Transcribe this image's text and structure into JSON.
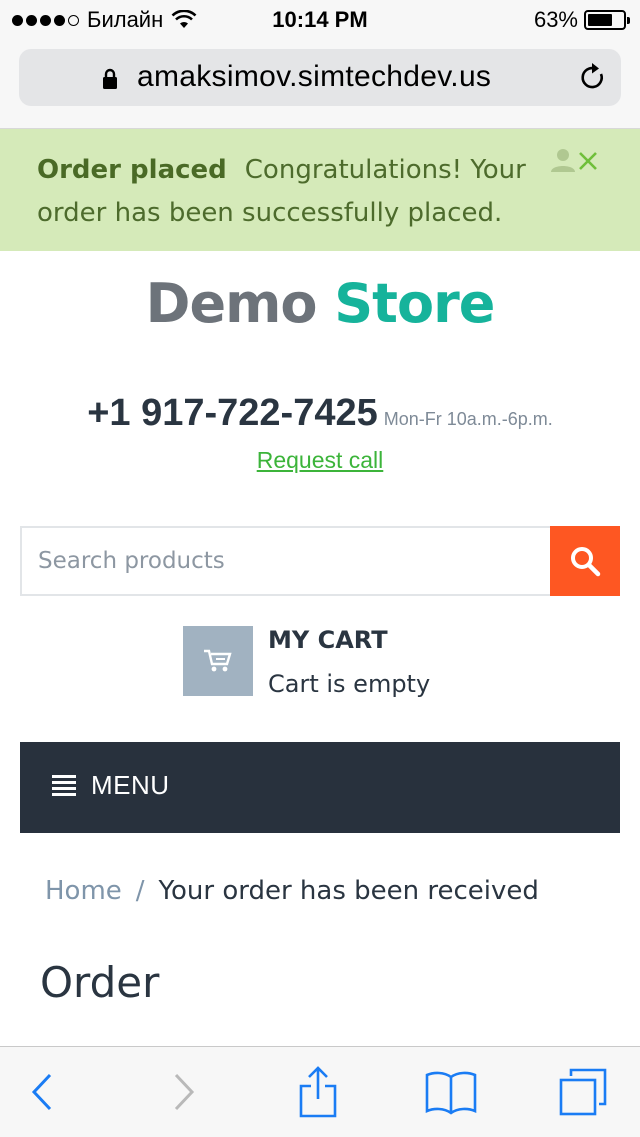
{
  "status_bar": {
    "carrier": "Билайн",
    "time": "10:14 PM",
    "battery": "63%",
    "battery_level": 0.63
  },
  "browser": {
    "url": "amaksimov.simtechdev.us"
  },
  "notice": {
    "title": "Order placed",
    "message": "Congratulations! Your order has been successfully placed.",
    "background": "#d5eab9"
  },
  "logo": {
    "part1": "Demo",
    "part2": "Store"
  },
  "contact": {
    "phone": "+1 917-722-7425",
    "hours": "Mon-Fr 10a.m.-6p.m.",
    "request_call": "Request call"
  },
  "search": {
    "placeholder": "Search products",
    "value": ""
  },
  "cart": {
    "title": "MY CART",
    "status": "Cart is empty"
  },
  "menu": {
    "label": "MENU"
  },
  "breadcrumb": {
    "home": "Home",
    "separator": "/",
    "current": "Your order has been received"
  },
  "page": {
    "heading": "Order"
  },
  "colors": {
    "accent_orange": "#fe5722",
    "brand_green": "#16b39b",
    "menu_dark": "#28313d",
    "link_green": "#3cb43a"
  }
}
